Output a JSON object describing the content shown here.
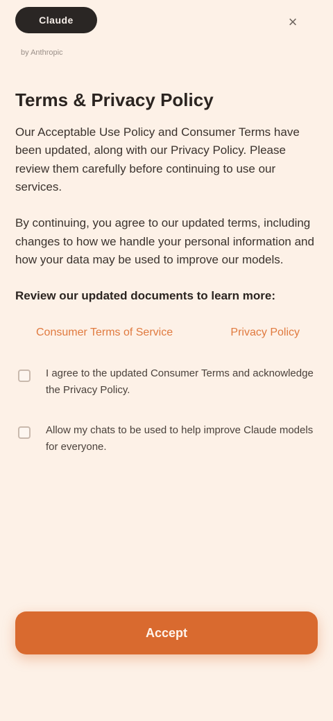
{
  "header": {
    "logo_text": "Claude",
    "sub_mark": "by Anthropic",
    "close_icon": "×"
  },
  "main": {
    "title": "Terms & Privacy Policy",
    "paragraph_1": "Our Acceptable Use Policy and Consumer Terms have been updated, along with our Privacy Policy. Please review them carefully before continuing to use our services.",
    "paragraph_2": "By continuing, you agree to our updated terms, including changes to how we handle your personal information and how your data may be used to improve our models.",
    "paragraph_3": "Review our updated documents to learn more:",
    "links": {
      "terms": "Consumer Terms of Service",
      "privacy": "Privacy Policy"
    },
    "checkboxes": [
      {
        "label": "I agree to the updated Consumer Terms and acknowledge the Privacy Policy."
      },
      {
        "label": "Allow my chats to be used to help improve Claude models for everyone."
      }
    ]
  },
  "footer": {
    "button_label": "Accept"
  }
}
